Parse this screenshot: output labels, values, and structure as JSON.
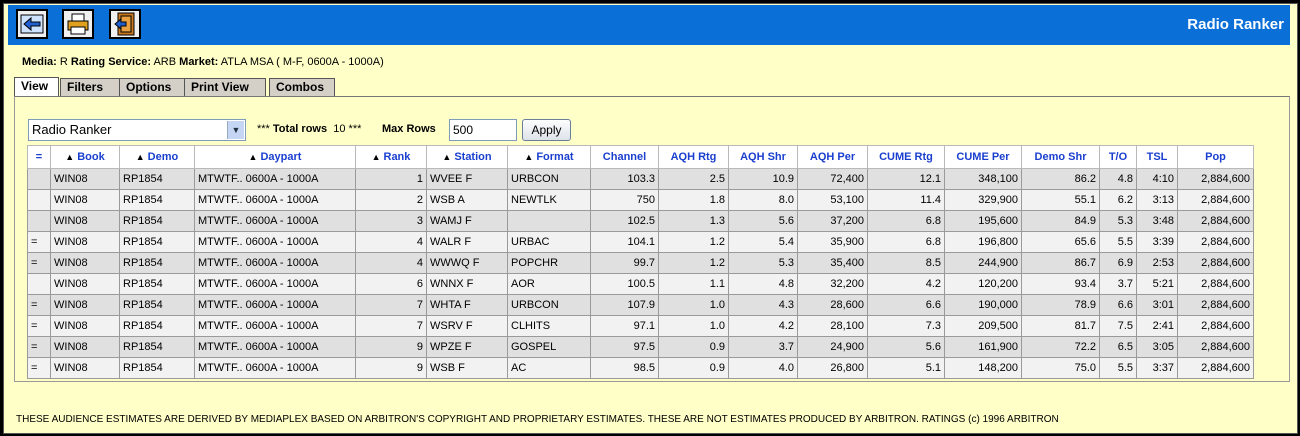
{
  "app": {
    "title": "Radio Ranker"
  },
  "toolbar": {
    "back_icon": "back-arrow-icon",
    "print_icon": "print-icon",
    "exit_icon": "exit-door-icon"
  },
  "info": {
    "media_label": "Media:",
    "media_value": "R",
    "service_label": "Rating Service:",
    "service_value": "ARB",
    "market_label": "Market:",
    "market_value": "ATLA MSA ( M-F, 0600A - 1000A)"
  },
  "tabs": [
    "View",
    "Filters",
    "Options",
    "Print View",
    "Combos"
  ],
  "controls": {
    "report_select": "Radio Ranker",
    "total_rows_prefix": "*** ",
    "total_rows_label": "Total rows",
    "total_rows_value": "10",
    "total_rows_suffix": " ***",
    "max_rows_label": "Max Rows",
    "max_rows_value": "500",
    "apply_label": "Apply"
  },
  "table": {
    "columns": [
      "=",
      "Book",
      "Demo",
      "Daypart",
      "Rank",
      "Station",
      "Format",
      "Channel",
      "AQH Rtg",
      "AQH Shr",
      "AQH Per",
      "CUME Rtg",
      "CUME Per",
      "Demo Shr",
      "T/O",
      "TSL",
      "Pop"
    ],
    "rows": [
      [
        "",
        "WIN08",
        "RP1854",
        "MTWTF.. 0600A - 1000A",
        "1",
        "WVEE F",
        "URBCON",
        "103.3",
        "2.5",
        "10.9",
        "72,400",
        "12.1",
        "348,100",
        "86.2",
        "4.8",
        "4:10",
        "2,884,600"
      ],
      [
        "",
        "WIN08",
        "RP1854",
        "MTWTF.. 0600A - 1000A",
        "2",
        "WSB A",
        "NEWTLK",
        "750",
        "1.8",
        "8.0",
        "53,100",
        "11.4",
        "329,900",
        "55.1",
        "6.2",
        "3:13",
        "2,884,600"
      ],
      [
        "",
        "WIN08",
        "RP1854",
        "MTWTF.. 0600A - 1000A",
        "3",
        "WAMJ F",
        "",
        "102.5",
        "1.3",
        "5.6",
        "37,200",
        "6.8",
        "195,600",
        "84.9",
        "5.3",
        "3:48",
        "2,884,600"
      ],
      [
        "=",
        "WIN08",
        "RP1854",
        "MTWTF.. 0600A - 1000A",
        "4",
        "WALR F",
        "URBAC",
        "104.1",
        "1.2",
        "5.4",
        "35,900",
        "6.8",
        "196,800",
        "65.6",
        "5.5",
        "3:39",
        "2,884,600"
      ],
      [
        "=",
        "WIN08",
        "RP1854",
        "MTWTF.. 0600A - 1000A",
        "4",
        "WWWQ F",
        "POPCHR",
        "99.7",
        "1.2",
        "5.3",
        "35,400",
        "8.5",
        "244,900",
        "86.7",
        "6.9",
        "2:53",
        "2,884,600"
      ],
      [
        "",
        "WIN08",
        "RP1854",
        "MTWTF.. 0600A - 1000A",
        "6",
        "WNNX F",
        "AOR",
        "100.5",
        "1.1",
        "4.8",
        "32,200",
        "4.2",
        "120,200",
        "93.4",
        "3.7",
        "5:21",
        "2,884,600"
      ],
      [
        "=",
        "WIN08",
        "RP1854",
        "MTWTF.. 0600A - 1000A",
        "7",
        "WHTA F",
        "URBCON",
        "107.9",
        "1.0",
        "4.3",
        "28,600",
        "6.6",
        "190,000",
        "78.9",
        "6.6",
        "3:01",
        "2,884,600"
      ],
      [
        "=",
        "WIN08",
        "RP1854",
        "MTWTF.. 0600A - 1000A",
        "7",
        "WSRV F",
        "CLHITS",
        "97.1",
        "1.0",
        "4.2",
        "28,100",
        "7.3",
        "209,500",
        "81.7",
        "7.5",
        "2:41",
        "2,884,600"
      ],
      [
        "=",
        "WIN08",
        "RP1854",
        "MTWTF.. 0600A - 1000A",
        "9",
        "WPZE F",
        "GOSPEL",
        "97.5",
        "0.9",
        "3.7",
        "24,900",
        "5.6",
        "161,900",
        "72.2",
        "6.5",
        "3:05",
        "2,884,600"
      ],
      [
        "=",
        "WIN08",
        "RP1854",
        "MTWTF.. 0600A - 1000A",
        "9",
        "WSB F",
        "AC",
        "98.5",
        "0.9",
        "4.0",
        "26,800",
        "5.1",
        "148,200",
        "75.0",
        "5.5",
        "3:37",
        "2,884,600"
      ]
    ]
  },
  "footer": {
    "text": "THESE AUDIENCE ESTIMATES ARE DERIVED BY MEDIAPLEX BASED ON ARBITRON'S COPYRIGHT AND PROPRIETARY ESTIMATES. THESE ARE NOT ESTIMATES PRODUCED BY ARBITRON. RATINGS (c) 1996 ARBITRON"
  }
}
